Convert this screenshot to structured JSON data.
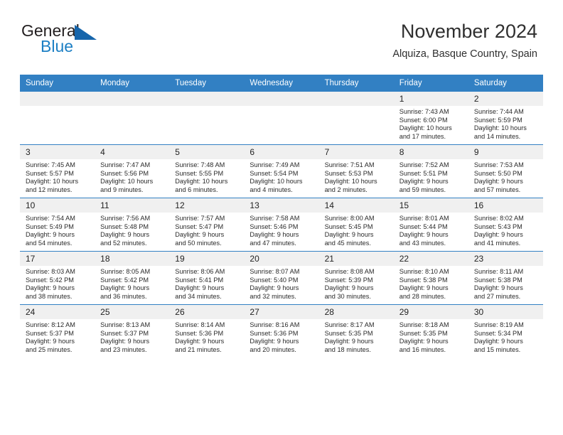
{
  "brand": {
    "name_part1": "General",
    "name_part2": "Blue",
    "logo_icon": "triangle-icon",
    "accent_color": "#1c7fc4",
    "triangle_color": "#1665ab"
  },
  "header": {
    "month_title": "November 2024",
    "location": "Alquiza, Basque Country, Spain",
    "header_bg_color": "#3280c3"
  },
  "weekday_headers": [
    "Sunday",
    "Monday",
    "Tuesday",
    "Wednesday",
    "Thursday",
    "Friday",
    "Saturday"
  ],
  "labels": {
    "sunrise": "Sunrise:",
    "sunset": "Sunset:",
    "daylight": "Daylight:"
  },
  "weeks": [
    [
      {
        "day": "",
        "blank": true
      },
      {
        "day": "",
        "blank": true
      },
      {
        "day": "",
        "blank": true
      },
      {
        "day": "",
        "blank": true
      },
      {
        "day": "",
        "blank": true
      },
      {
        "day": "1",
        "sunrise": "Sunrise: 7:43 AM",
        "sunset": "Sunset: 6:00 PM",
        "daylight_1": "Daylight: 10 hours",
        "daylight_2": "and 17 minutes."
      },
      {
        "day": "2",
        "sunrise": "Sunrise: 7:44 AM",
        "sunset": "Sunset: 5:59 PM",
        "daylight_1": "Daylight: 10 hours",
        "daylight_2": "and 14 minutes."
      }
    ],
    [
      {
        "day": "3",
        "sunrise": "Sunrise: 7:45 AM",
        "sunset": "Sunset: 5:57 PM",
        "daylight_1": "Daylight: 10 hours",
        "daylight_2": "and 12 minutes."
      },
      {
        "day": "4",
        "sunrise": "Sunrise: 7:47 AM",
        "sunset": "Sunset: 5:56 PM",
        "daylight_1": "Daylight: 10 hours",
        "daylight_2": "and 9 minutes."
      },
      {
        "day": "5",
        "sunrise": "Sunrise: 7:48 AM",
        "sunset": "Sunset: 5:55 PM",
        "daylight_1": "Daylight: 10 hours",
        "daylight_2": "and 6 minutes."
      },
      {
        "day": "6",
        "sunrise": "Sunrise: 7:49 AM",
        "sunset": "Sunset: 5:54 PM",
        "daylight_1": "Daylight: 10 hours",
        "daylight_2": "and 4 minutes."
      },
      {
        "day": "7",
        "sunrise": "Sunrise: 7:51 AM",
        "sunset": "Sunset: 5:53 PM",
        "daylight_1": "Daylight: 10 hours",
        "daylight_2": "and 2 minutes."
      },
      {
        "day": "8",
        "sunrise": "Sunrise: 7:52 AM",
        "sunset": "Sunset: 5:51 PM",
        "daylight_1": "Daylight: 9 hours",
        "daylight_2": "and 59 minutes."
      },
      {
        "day": "9",
        "sunrise": "Sunrise: 7:53 AM",
        "sunset": "Sunset: 5:50 PM",
        "daylight_1": "Daylight: 9 hours",
        "daylight_2": "and 57 minutes."
      }
    ],
    [
      {
        "day": "10",
        "sunrise": "Sunrise: 7:54 AM",
        "sunset": "Sunset: 5:49 PM",
        "daylight_1": "Daylight: 9 hours",
        "daylight_2": "and 54 minutes."
      },
      {
        "day": "11",
        "sunrise": "Sunrise: 7:56 AM",
        "sunset": "Sunset: 5:48 PM",
        "daylight_1": "Daylight: 9 hours",
        "daylight_2": "and 52 minutes."
      },
      {
        "day": "12",
        "sunrise": "Sunrise: 7:57 AM",
        "sunset": "Sunset: 5:47 PM",
        "daylight_1": "Daylight: 9 hours",
        "daylight_2": "and 50 minutes."
      },
      {
        "day": "13",
        "sunrise": "Sunrise: 7:58 AM",
        "sunset": "Sunset: 5:46 PM",
        "daylight_1": "Daylight: 9 hours",
        "daylight_2": "and 47 minutes."
      },
      {
        "day": "14",
        "sunrise": "Sunrise: 8:00 AM",
        "sunset": "Sunset: 5:45 PM",
        "daylight_1": "Daylight: 9 hours",
        "daylight_2": "and 45 minutes."
      },
      {
        "day": "15",
        "sunrise": "Sunrise: 8:01 AM",
        "sunset": "Sunset: 5:44 PM",
        "daylight_1": "Daylight: 9 hours",
        "daylight_2": "and 43 minutes."
      },
      {
        "day": "16",
        "sunrise": "Sunrise: 8:02 AM",
        "sunset": "Sunset: 5:43 PM",
        "daylight_1": "Daylight: 9 hours",
        "daylight_2": "and 41 minutes."
      }
    ],
    [
      {
        "day": "17",
        "sunrise": "Sunrise: 8:03 AM",
        "sunset": "Sunset: 5:42 PM",
        "daylight_1": "Daylight: 9 hours",
        "daylight_2": "and 38 minutes."
      },
      {
        "day": "18",
        "sunrise": "Sunrise: 8:05 AM",
        "sunset": "Sunset: 5:42 PM",
        "daylight_1": "Daylight: 9 hours",
        "daylight_2": "and 36 minutes."
      },
      {
        "day": "19",
        "sunrise": "Sunrise: 8:06 AM",
        "sunset": "Sunset: 5:41 PM",
        "daylight_1": "Daylight: 9 hours",
        "daylight_2": "and 34 minutes."
      },
      {
        "day": "20",
        "sunrise": "Sunrise: 8:07 AM",
        "sunset": "Sunset: 5:40 PM",
        "daylight_1": "Daylight: 9 hours",
        "daylight_2": "and 32 minutes."
      },
      {
        "day": "21",
        "sunrise": "Sunrise: 8:08 AM",
        "sunset": "Sunset: 5:39 PM",
        "daylight_1": "Daylight: 9 hours",
        "daylight_2": "and 30 minutes."
      },
      {
        "day": "22",
        "sunrise": "Sunrise: 8:10 AM",
        "sunset": "Sunset: 5:38 PM",
        "daylight_1": "Daylight: 9 hours",
        "daylight_2": "and 28 minutes."
      },
      {
        "day": "23",
        "sunrise": "Sunrise: 8:11 AM",
        "sunset": "Sunset: 5:38 PM",
        "daylight_1": "Daylight: 9 hours",
        "daylight_2": "and 27 minutes."
      }
    ],
    [
      {
        "day": "24",
        "sunrise": "Sunrise: 8:12 AM",
        "sunset": "Sunset: 5:37 PM",
        "daylight_1": "Daylight: 9 hours",
        "daylight_2": "and 25 minutes."
      },
      {
        "day": "25",
        "sunrise": "Sunrise: 8:13 AM",
        "sunset": "Sunset: 5:37 PM",
        "daylight_1": "Daylight: 9 hours",
        "daylight_2": "and 23 minutes."
      },
      {
        "day": "26",
        "sunrise": "Sunrise: 8:14 AM",
        "sunset": "Sunset: 5:36 PM",
        "daylight_1": "Daylight: 9 hours",
        "daylight_2": "and 21 minutes."
      },
      {
        "day": "27",
        "sunrise": "Sunrise: 8:16 AM",
        "sunset": "Sunset: 5:36 PM",
        "daylight_1": "Daylight: 9 hours",
        "daylight_2": "and 20 minutes."
      },
      {
        "day": "28",
        "sunrise": "Sunrise: 8:17 AM",
        "sunset": "Sunset: 5:35 PM",
        "daylight_1": "Daylight: 9 hours",
        "daylight_2": "and 18 minutes."
      },
      {
        "day": "29",
        "sunrise": "Sunrise: 8:18 AM",
        "sunset": "Sunset: 5:35 PM",
        "daylight_1": "Daylight: 9 hours",
        "daylight_2": "and 16 minutes."
      },
      {
        "day": "30",
        "sunrise": "Sunrise: 8:19 AM",
        "sunset": "Sunset: 5:34 PM",
        "daylight_1": "Daylight: 9 hours",
        "daylight_2": "and 15 minutes."
      }
    ]
  ]
}
